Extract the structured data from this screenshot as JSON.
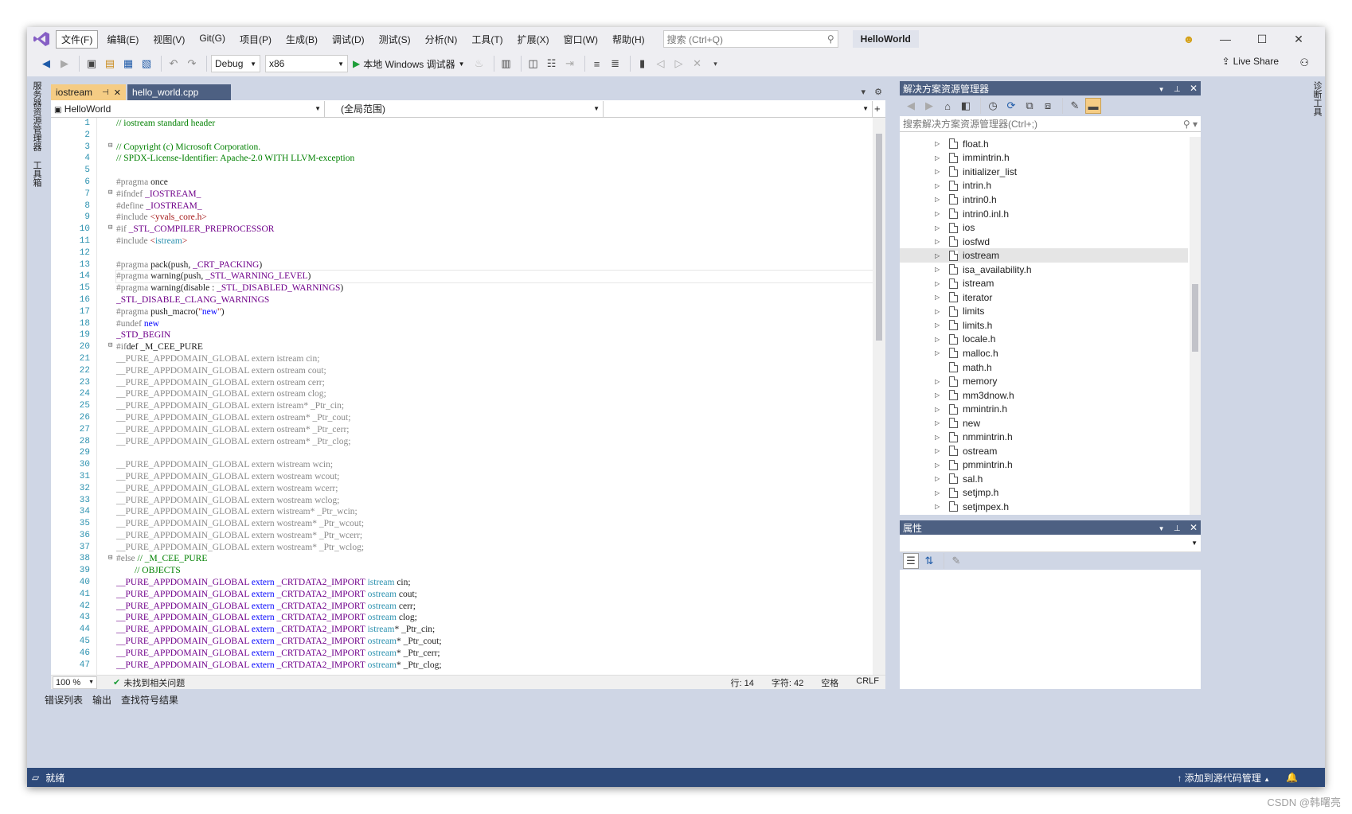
{
  "menu": {
    "items": [
      "文件(F)",
      "编辑(E)",
      "视图(V)",
      "Git(G)",
      "项目(P)",
      "生成(B)",
      "调试(D)",
      "测试(S)",
      "分析(N)",
      "工具(T)",
      "扩展(X)",
      "窗口(W)",
      "帮助(H)"
    ],
    "search_placeholder": "搜索 (Ctrl+Q)",
    "project_title": "HelloWorld"
  },
  "toolbar": {
    "config": "Debug",
    "platform": "x86",
    "run_label": "本地 Windows 调试器",
    "live_share": "Live Share"
  },
  "left_rail": [
    "服务器资源管理器",
    "工具箱"
  ],
  "right_rail": [
    "诊断工具"
  ],
  "editor": {
    "tabs": [
      {
        "label": "iostream",
        "active": true
      },
      {
        "label": "hello_world.cpp",
        "active": false
      }
    ],
    "nav_project": "HelloWorld",
    "nav_scope": "(全局范围)",
    "zoom": "100 %",
    "issues": "未找到相关问题",
    "line_info": "行: 14",
    "char_info": "字符: 42",
    "whitespace": "空格",
    "line_ending": "CRLF",
    "lines": [
      "1",
      "2",
      "3",
      "4",
      "5",
      "6",
      "7",
      "8",
      "9",
      "10",
      "11",
      "12",
      "13",
      "14",
      "15",
      "16",
      "17",
      "18",
      "19",
      "20",
      "21",
      "22",
      "23",
      "24",
      "25",
      "26",
      "27",
      "28",
      "29",
      "30",
      "31",
      "32",
      "33",
      "34",
      "35",
      "36",
      "37",
      "38",
      "39",
      "40",
      "41",
      "42",
      "43",
      "44",
      "45",
      "46",
      "47"
    ],
    "code": [
      "// iostream standard header",
      "",
      "// Copyright (c) Microsoft Corporation.",
      "// SPDX-License-Identifier: Apache-2.0 WITH LLVM-exception",
      "",
      "#pragma once",
      "#ifndef _IOSTREAM_",
      "#define _IOSTREAM_",
      "#include <yvals_core.h>",
      "#if _STL_COMPILER_PREPROCESSOR",
      "#include <istream>",
      "",
      "#pragma pack(push, _CRT_PACKING)",
      "#pragma warning(push, _STL_WARNING_LEVEL)",
      "#pragma warning(disable : _STL_DISABLED_WARNINGS)",
      "_STL_DISABLE_CLANG_WARNINGS",
      "#pragma push_macro(\"new\")",
      "#undef new",
      "_STD_BEGIN",
      "#ifdef _M_CEE_PURE",
      "__PURE_APPDOMAIN_GLOBAL extern istream cin;",
      "__PURE_APPDOMAIN_GLOBAL extern ostream cout;",
      "__PURE_APPDOMAIN_GLOBAL extern ostream cerr;",
      "__PURE_APPDOMAIN_GLOBAL extern ostream clog;",
      "__PURE_APPDOMAIN_GLOBAL extern istream* _Ptr_cin;",
      "__PURE_APPDOMAIN_GLOBAL extern ostream* _Ptr_cout;",
      "__PURE_APPDOMAIN_GLOBAL extern ostream* _Ptr_cerr;",
      "__PURE_APPDOMAIN_GLOBAL extern ostream* _Ptr_clog;",
      "",
      "__PURE_APPDOMAIN_GLOBAL extern wistream wcin;",
      "__PURE_APPDOMAIN_GLOBAL extern wostream wcout;",
      "__PURE_APPDOMAIN_GLOBAL extern wostream wcerr;",
      "__PURE_APPDOMAIN_GLOBAL extern wostream wclog;",
      "__PURE_APPDOMAIN_GLOBAL extern wistream* _Ptr_wcin;",
      "__PURE_APPDOMAIN_GLOBAL extern wostream* _Ptr_wcout;",
      "__PURE_APPDOMAIN_GLOBAL extern wostream* _Ptr_wcerr;",
      "__PURE_APPDOMAIN_GLOBAL extern wostream* _Ptr_wclog;",
      "#else // _M_CEE_PURE",
      "        // OBJECTS",
      "__PURE_APPDOMAIN_GLOBAL extern _CRTDATA2_IMPORT istream cin;",
      "__PURE_APPDOMAIN_GLOBAL extern _CRTDATA2_IMPORT ostream cout;",
      "__PURE_APPDOMAIN_GLOBAL extern _CRTDATA2_IMPORT ostream cerr;",
      "__PURE_APPDOMAIN_GLOBAL extern _CRTDATA2_IMPORT ostream clog;",
      "__PURE_APPDOMAIN_GLOBAL extern _CRTDATA2_IMPORT istream* _Ptr_cin;",
      "__PURE_APPDOMAIN_GLOBAL extern _CRTDATA2_IMPORT ostream* _Ptr_cout;",
      "__PURE_APPDOMAIN_GLOBAL extern _CRTDATA2_IMPORT ostream* _Ptr_cerr;",
      "__PURE_APPDOMAIN_GLOBAL extern _CRTDATA2_IMPORT ostream* _Ptr_clog;"
    ]
  },
  "solution_explorer": {
    "title": "解决方案资源管理器",
    "search_placeholder": "搜索解决方案资源管理器(Ctrl+;)",
    "files": [
      {
        "name": "float.h",
        "expandable": true
      },
      {
        "name": "immintrin.h",
        "expandable": true
      },
      {
        "name": "initializer_list",
        "expandable": true
      },
      {
        "name": "intrin.h",
        "expandable": true
      },
      {
        "name": "intrin0.h",
        "expandable": true
      },
      {
        "name": "intrin0.inl.h",
        "expandable": true
      },
      {
        "name": "ios",
        "expandable": true
      },
      {
        "name": "iosfwd",
        "expandable": true
      },
      {
        "name": "iostream",
        "expandable": true,
        "selected": true
      },
      {
        "name": "isa_availability.h",
        "expandable": true
      },
      {
        "name": "istream",
        "expandable": true
      },
      {
        "name": "iterator",
        "expandable": true
      },
      {
        "name": "limits",
        "expandable": true
      },
      {
        "name": "limits.h",
        "expandable": true
      },
      {
        "name": "locale.h",
        "expandable": true
      },
      {
        "name": "malloc.h",
        "expandable": true
      },
      {
        "name": "math.h",
        "expandable": false
      },
      {
        "name": "memory",
        "expandable": true
      },
      {
        "name": "mm3dnow.h",
        "expandable": true
      },
      {
        "name": "mmintrin.h",
        "expandable": true
      },
      {
        "name": "new",
        "expandable": true
      },
      {
        "name": "nmmintrin.h",
        "expandable": true
      },
      {
        "name": "ostream",
        "expandable": true
      },
      {
        "name": "pmmintrin.h",
        "expandable": true
      },
      {
        "name": "sal.h",
        "expandable": true
      },
      {
        "name": "setjmp.h",
        "expandable": true
      },
      {
        "name": "setjmpex.h",
        "expandable": true
      }
    ]
  },
  "properties": {
    "title": "属性"
  },
  "bottom_tabs": [
    "错误列表",
    "输出",
    "查找符号结果"
  ],
  "status": {
    "ready": "就绪",
    "source_control": "添加到源代码管理"
  },
  "watermark": "CSDN @韩曙亮",
  "colors": {
    "accent": "#4d6082",
    "tab_active": "#f5cc84",
    "status_bar": "#2e4a7a",
    "comment": "#008000",
    "keyword": "#0000ff",
    "macro": "#6f008a"
  }
}
